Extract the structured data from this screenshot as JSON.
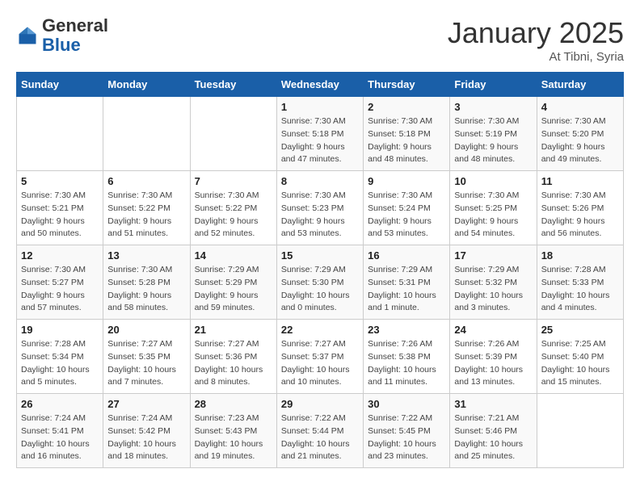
{
  "header": {
    "logo_general": "General",
    "logo_blue": "Blue",
    "title": "January 2025",
    "subtitle": "At Tibni, Syria"
  },
  "days_of_week": [
    "Sunday",
    "Monday",
    "Tuesday",
    "Wednesday",
    "Thursday",
    "Friday",
    "Saturday"
  ],
  "weeks": [
    [
      {
        "day": "",
        "info": ""
      },
      {
        "day": "",
        "info": ""
      },
      {
        "day": "",
        "info": ""
      },
      {
        "day": "1",
        "info": "Sunrise: 7:30 AM\nSunset: 5:18 PM\nDaylight: 9 hours\nand 47 minutes."
      },
      {
        "day": "2",
        "info": "Sunrise: 7:30 AM\nSunset: 5:18 PM\nDaylight: 9 hours\nand 48 minutes."
      },
      {
        "day": "3",
        "info": "Sunrise: 7:30 AM\nSunset: 5:19 PM\nDaylight: 9 hours\nand 48 minutes."
      },
      {
        "day": "4",
        "info": "Sunrise: 7:30 AM\nSunset: 5:20 PM\nDaylight: 9 hours\nand 49 minutes."
      }
    ],
    [
      {
        "day": "5",
        "info": "Sunrise: 7:30 AM\nSunset: 5:21 PM\nDaylight: 9 hours\nand 50 minutes."
      },
      {
        "day": "6",
        "info": "Sunrise: 7:30 AM\nSunset: 5:22 PM\nDaylight: 9 hours\nand 51 minutes."
      },
      {
        "day": "7",
        "info": "Sunrise: 7:30 AM\nSunset: 5:22 PM\nDaylight: 9 hours\nand 52 minutes."
      },
      {
        "day": "8",
        "info": "Sunrise: 7:30 AM\nSunset: 5:23 PM\nDaylight: 9 hours\nand 53 minutes."
      },
      {
        "day": "9",
        "info": "Sunrise: 7:30 AM\nSunset: 5:24 PM\nDaylight: 9 hours\nand 53 minutes."
      },
      {
        "day": "10",
        "info": "Sunrise: 7:30 AM\nSunset: 5:25 PM\nDaylight: 9 hours\nand 54 minutes."
      },
      {
        "day": "11",
        "info": "Sunrise: 7:30 AM\nSunset: 5:26 PM\nDaylight: 9 hours\nand 56 minutes."
      }
    ],
    [
      {
        "day": "12",
        "info": "Sunrise: 7:30 AM\nSunset: 5:27 PM\nDaylight: 9 hours\nand 57 minutes."
      },
      {
        "day": "13",
        "info": "Sunrise: 7:30 AM\nSunset: 5:28 PM\nDaylight: 9 hours\nand 58 minutes."
      },
      {
        "day": "14",
        "info": "Sunrise: 7:29 AM\nSunset: 5:29 PM\nDaylight: 9 hours\nand 59 minutes."
      },
      {
        "day": "15",
        "info": "Sunrise: 7:29 AM\nSunset: 5:30 PM\nDaylight: 10 hours\nand 0 minutes."
      },
      {
        "day": "16",
        "info": "Sunrise: 7:29 AM\nSunset: 5:31 PM\nDaylight: 10 hours\nand 1 minute."
      },
      {
        "day": "17",
        "info": "Sunrise: 7:29 AM\nSunset: 5:32 PM\nDaylight: 10 hours\nand 3 minutes."
      },
      {
        "day": "18",
        "info": "Sunrise: 7:28 AM\nSunset: 5:33 PM\nDaylight: 10 hours\nand 4 minutes."
      }
    ],
    [
      {
        "day": "19",
        "info": "Sunrise: 7:28 AM\nSunset: 5:34 PM\nDaylight: 10 hours\nand 5 minutes."
      },
      {
        "day": "20",
        "info": "Sunrise: 7:27 AM\nSunset: 5:35 PM\nDaylight: 10 hours\nand 7 minutes."
      },
      {
        "day": "21",
        "info": "Sunrise: 7:27 AM\nSunset: 5:36 PM\nDaylight: 10 hours\nand 8 minutes."
      },
      {
        "day": "22",
        "info": "Sunrise: 7:27 AM\nSunset: 5:37 PM\nDaylight: 10 hours\nand 10 minutes."
      },
      {
        "day": "23",
        "info": "Sunrise: 7:26 AM\nSunset: 5:38 PM\nDaylight: 10 hours\nand 11 minutes."
      },
      {
        "day": "24",
        "info": "Sunrise: 7:26 AM\nSunset: 5:39 PM\nDaylight: 10 hours\nand 13 minutes."
      },
      {
        "day": "25",
        "info": "Sunrise: 7:25 AM\nSunset: 5:40 PM\nDaylight: 10 hours\nand 15 minutes."
      }
    ],
    [
      {
        "day": "26",
        "info": "Sunrise: 7:24 AM\nSunset: 5:41 PM\nDaylight: 10 hours\nand 16 minutes."
      },
      {
        "day": "27",
        "info": "Sunrise: 7:24 AM\nSunset: 5:42 PM\nDaylight: 10 hours\nand 18 minutes."
      },
      {
        "day": "28",
        "info": "Sunrise: 7:23 AM\nSunset: 5:43 PM\nDaylight: 10 hours\nand 19 minutes."
      },
      {
        "day": "29",
        "info": "Sunrise: 7:22 AM\nSunset: 5:44 PM\nDaylight: 10 hours\nand 21 minutes."
      },
      {
        "day": "30",
        "info": "Sunrise: 7:22 AM\nSunset: 5:45 PM\nDaylight: 10 hours\nand 23 minutes."
      },
      {
        "day": "31",
        "info": "Sunrise: 7:21 AM\nSunset: 5:46 PM\nDaylight: 10 hours\nand 25 minutes."
      },
      {
        "day": "",
        "info": ""
      }
    ]
  ]
}
